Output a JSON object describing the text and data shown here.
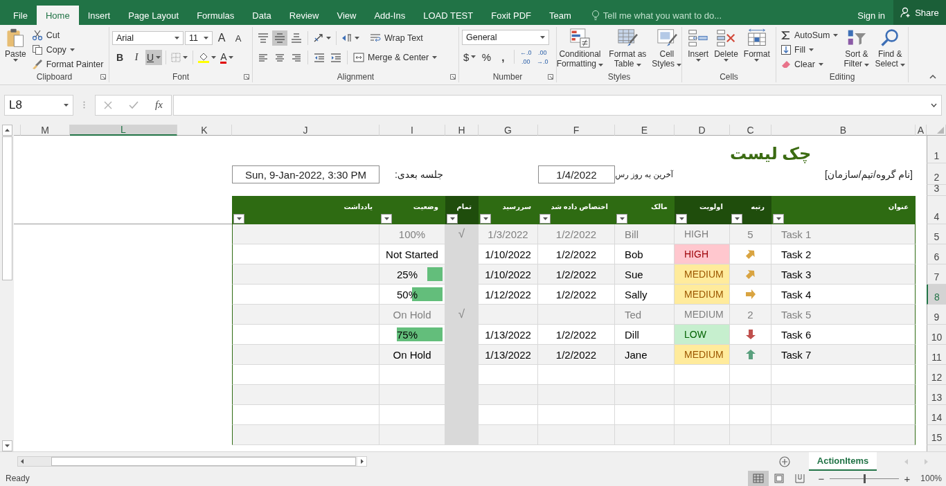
{
  "ribbon_tabs": [
    {
      "label": "File",
      "selected": false
    },
    {
      "label": "Home",
      "selected": true
    },
    {
      "label": "Insert",
      "selected": false
    },
    {
      "label": "Page Layout",
      "selected": false
    },
    {
      "label": "Formulas",
      "selected": false
    },
    {
      "label": "Data",
      "selected": false
    },
    {
      "label": "Review",
      "selected": false
    },
    {
      "label": "View",
      "selected": false
    },
    {
      "label": "Add-Ins",
      "selected": false
    },
    {
      "label": "LOAD TEST",
      "selected": false
    },
    {
      "label": "Foxit PDF",
      "selected": false
    },
    {
      "label": "Team",
      "selected": false
    }
  ],
  "tell_me": {
    "placeholder": "Tell me what you want to do..."
  },
  "sign_in": "Sign in",
  "share": "Share",
  "ribbon": {
    "clipboard": {
      "title": "Clipboard",
      "paste": "Paste",
      "cut": "Cut",
      "copy": "Copy",
      "format_painter": "Format Painter"
    },
    "font": {
      "title": "Font",
      "font_name": "Arial",
      "font_size": "11",
      "grow": "A",
      "shrink": "A",
      "bold": "B",
      "italic": "I",
      "underline": "U",
      "underline_on": true,
      "font_color": "A"
    },
    "alignment": {
      "title": "Alignment",
      "middle_align_on": true,
      "wrap_text": "Wrap Text",
      "merge_center": "Merge & Center"
    },
    "number": {
      "title": "Number",
      "format": "General",
      "currency": "$",
      "percent": "%",
      "comma": ",",
      "increase_decimal": [
        "←.0",
        ".00"
      ],
      "decrease_decimal": [
        ".00",
        "→.0"
      ]
    },
    "styles": {
      "title": "Styles",
      "buttons": [
        [
          "Conditional",
          "Formatting"
        ],
        [
          "Format as",
          "Table"
        ],
        [
          "Cell",
          "Styles"
        ]
      ]
    },
    "cells": {
      "title": "Cells",
      "buttons": [
        "Insert",
        "Delete",
        "Format"
      ]
    },
    "editing": {
      "title": "Editing",
      "autosum": "AutoSum",
      "fill": "Fill",
      "clear": "Clear",
      "sort_filter": [
        "Sort &",
        "Filter"
      ],
      "find_select": [
        "Find &",
        "Select"
      ]
    }
  },
  "formula_bar": {
    "name_box": "L8",
    "fx": "fx"
  },
  "column_headers": [
    {
      "label": "M",
      "selected": false
    },
    {
      "label": "L",
      "selected": true
    },
    {
      "label": "K",
      "selected": false
    },
    {
      "label": "J",
      "selected": false
    },
    {
      "label": "I",
      "selected": false
    },
    {
      "label": "H",
      "selected": false
    },
    {
      "label": "G",
      "selected": false
    },
    {
      "label": "F",
      "selected": false
    },
    {
      "label": "E",
      "selected": false
    },
    {
      "label": "D",
      "selected": false
    },
    {
      "label": "C",
      "selected": false
    },
    {
      "label": "B",
      "selected": false
    },
    {
      "label": "A",
      "selected": false
    }
  ],
  "row_headers": [
    {
      "label": "1",
      "selected": false
    },
    {
      "label": "2",
      "selected": false
    },
    {
      "label": "3",
      "selected": false
    },
    {
      "label": "4",
      "selected": false
    },
    {
      "label": "5",
      "selected": false
    },
    {
      "label": "6",
      "selected": false
    },
    {
      "label": "7",
      "selected": false
    },
    {
      "label": "8",
      "selected": true
    },
    {
      "label": "9",
      "selected": false
    },
    {
      "label": "10",
      "selected": false
    },
    {
      "label": "11",
      "selected": false
    },
    {
      "label": "12",
      "selected": false
    },
    {
      "label": "13",
      "selected": false
    },
    {
      "label": "14",
      "selected": false
    },
    {
      "label": "15",
      "selected": false
    }
  ],
  "sheet": {
    "title": "چک لیست",
    "organization": "[نام گروه/تیم/سازمان]",
    "last_updated_label": "آخرین به روز رس",
    "last_updated": "1/4/2022",
    "next_meeting_label": "جلسه بعدی:",
    "next_meeting": "Sun, 9-Jan-2022, 3:30 PM"
  },
  "table": {
    "headers": [
      {
        "label": "عنوان",
        "highlighted": false
      },
      {
        "label": "رتبه",
        "highlighted": true
      },
      {
        "label": "اولویت",
        "highlighted": true
      },
      {
        "label": "مالک",
        "highlighted": false
      },
      {
        "label": "اختصاص داده شد",
        "highlighted": false
      },
      {
        "label": "سررسید",
        "highlighted": false
      },
      {
        "label": "تمام",
        "highlighted": true
      },
      {
        "label": "وضعیت",
        "highlighted": false
      },
      {
        "label": "یادداشت",
        "highlighted": false
      }
    ],
    "rows": [
      {
        "title": "Task 1",
        "rank": "5",
        "priority": {
          "label": "HIGH",
          "kind": "high"
        },
        "owner": "Bill",
        "assigned": "1/2/2022",
        "due": "1/3/2022",
        "done": true,
        "check": "√",
        "status": "100%"
      },
      {
        "title": "Task 2",
        "rank_icon": {
          "kind": "up_right"
        },
        "priority": {
          "label": "HIGH",
          "kind": "high"
        },
        "owner": "Bob",
        "assigned": "1/2/2022",
        "due": "1/10/2022",
        "done": false,
        "status": "Not Started"
      },
      {
        "title": "Task 3",
        "rank_icon": {
          "kind": "up_right"
        },
        "priority": {
          "label": "MEDIUM",
          "kind": "medium"
        },
        "owner": "Sue",
        "assigned": "1/2/2022",
        "due": "1/10/2022",
        "done": false,
        "status": "25%",
        "level": 0.25
      },
      {
        "title": "Task 4",
        "rank_icon": {
          "kind": "right"
        },
        "priority": {
          "label": "MEDIUM",
          "kind": "medium"
        },
        "owner": "Sally",
        "assigned": "1/2/2022",
        "due": "1/12/2022",
        "done": false,
        "status": "50%",
        "level": 0.5
      },
      {
        "title": "Task 5",
        "rank": "2",
        "priority": {
          "label": "MEDIUM",
          "kind": "medium"
        },
        "owner": "Ted",
        "done": true,
        "check": "√",
        "status": "On Hold"
      },
      {
        "title": "Task 6",
        "rank_icon": {
          "kind": "down"
        },
        "priority": {
          "label": "LOW",
          "kind": "low"
        },
        "owner": "Dill",
        "assigned": "1/2/2022",
        "due": "1/13/2022",
        "done": false,
        "status": "75%",
        "level": 0.75
      },
      {
        "title": "Task 7",
        "rank_icon": {
          "kind": "up"
        },
        "priority": {
          "label": "MEDIUM",
          "kind": "medium"
        },
        "owner": "Jane",
        "assigned": "1/2/2022",
        "due": "1/13/2022",
        "done": false,
        "status": "On Hold"
      }
    ]
  },
  "sheet_tabs": [
    {
      "label": "ActionItems",
      "selected": true
    }
  ],
  "status_bar": {
    "status": "Ready",
    "views": [
      {
        "selected": true
      },
      {
        "selected": false
      },
      {
        "selected": false
      }
    ],
    "zoom_out": "−",
    "zoom_in": "+",
    "zoom_slider": {
      "level": 0.5
    },
    "zoom": "100%"
  }
}
